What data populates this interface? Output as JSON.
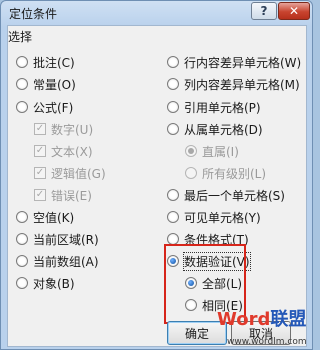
{
  "window": {
    "title": "定位条件",
    "help_icon": "help-icon",
    "close_icon": "close-icon"
  },
  "group_label": "选择",
  "left": [
    {
      "label": "批注(C)",
      "checked": false
    },
    {
      "label": "常量(O)",
      "checked": false
    },
    {
      "label": "公式(F)",
      "checked": false
    },
    {
      "label": "数字(U)",
      "sub": true
    },
    {
      "label": "文本(X)",
      "sub": true
    },
    {
      "label": "逻辑值(G)",
      "sub": true
    },
    {
      "label": "错误(E)",
      "sub": true
    },
    {
      "label": "空值(K)",
      "checked": false
    },
    {
      "label": "当前区域(R)",
      "checked": false
    },
    {
      "label": "当前数组(A)",
      "checked": false
    },
    {
      "label": "对象(B)",
      "checked": false
    }
  ],
  "right": [
    {
      "label": "行内容差异单元格(W)"
    },
    {
      "label": "列内容差异单元格(M)"
    },
    {
      "label": "引用单元格(P)"
    },
    {
      "label": "从属单元格(D)"
    },
    {
      "label": "直属(I)",
      "sub": true
    },
    {
      "label": "所有级别(L)",
      "sub": true
    },
    {
      "label": "最后一个单元格(S)"
    },
    {
      "label": "可见单元格(Y)"
    },
    {
      "label": "条件格式(T)"
    },
    {
      "label": "数据验证(V)",
      "checked": true
    },
    {
      "label": "全部(L)",
      "sub": true,
      "checked": true
    },
    {
      "label": "相同(E)",
      "sub": true
    }
  ],
  "buttons": {
    "ok": "确定",
    "cancel": "取消"
  },
  "watermark": {
    "word": "Word",
    "cn": "联盟",
    "url": "www.wordlm.com"
  },
  "colors": {
    "highlight": "#d6251a",
    "titlebar": "#b9d1ec"
  }
}
